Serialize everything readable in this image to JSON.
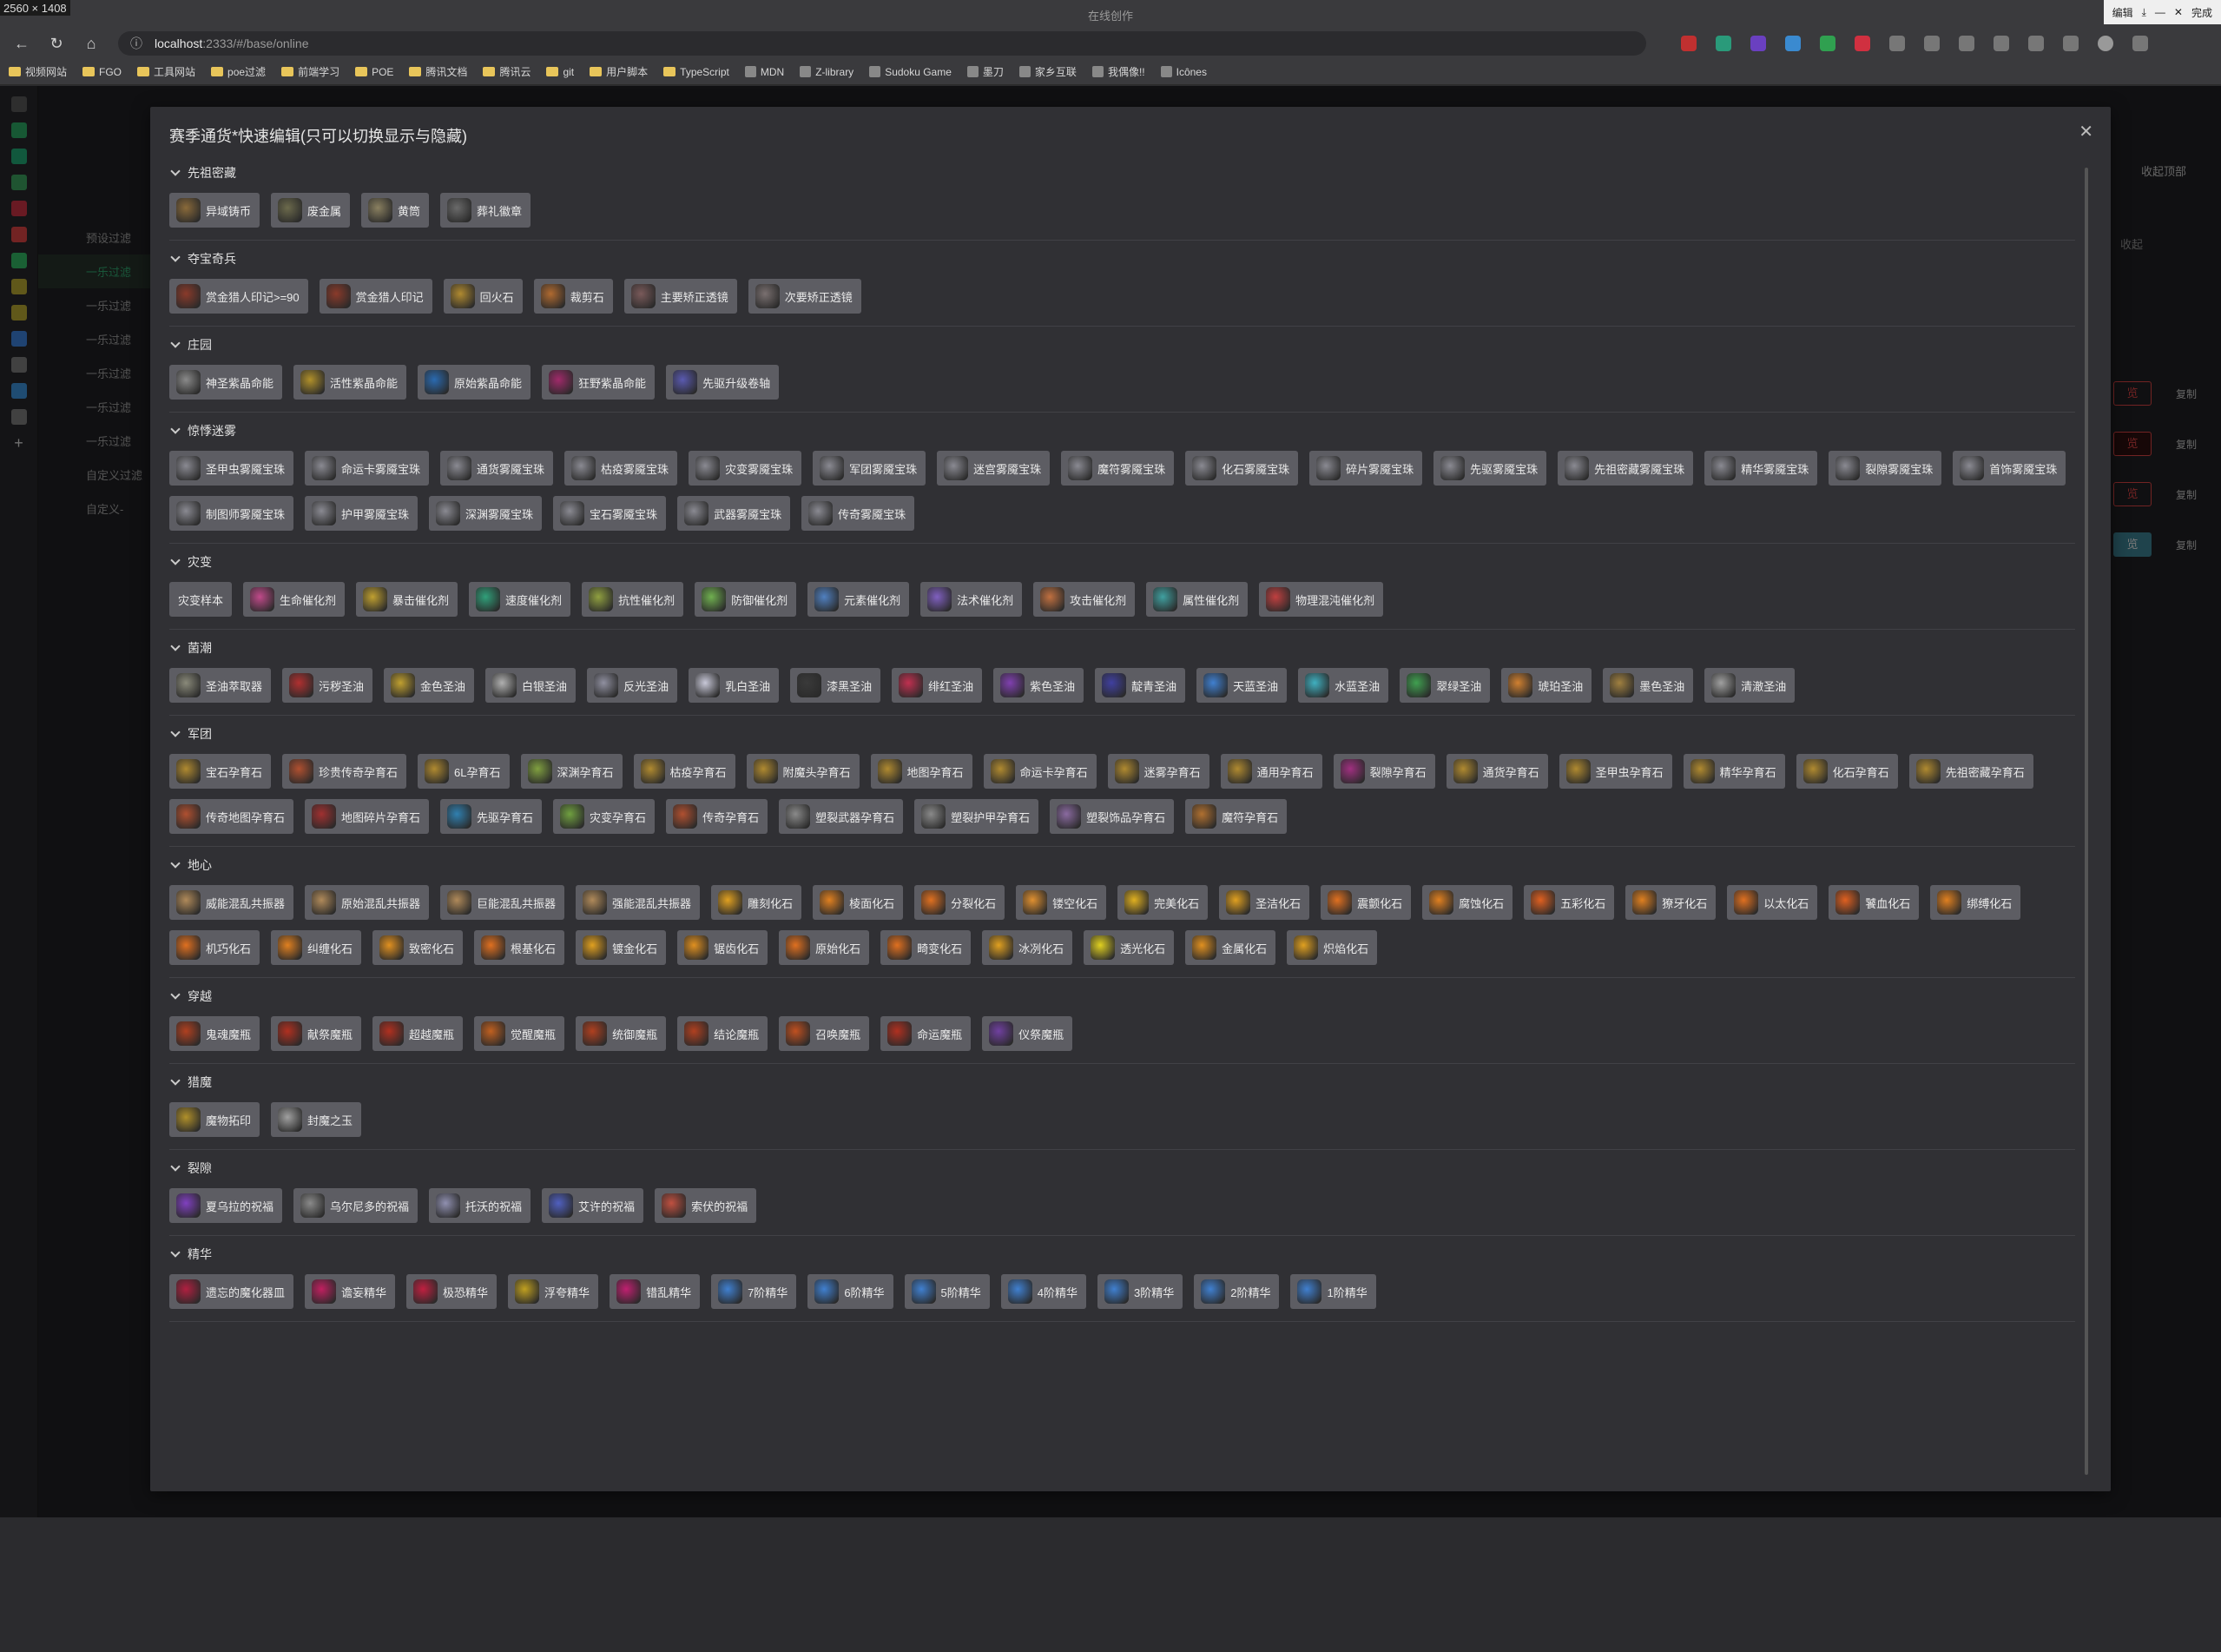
{
  "screen_label": "2560 × 1408",
  "window": {
    "title": "在线创作",
    "controls": [
      "编辑",
      "完成"
    ]
  },
  "browser": {
    "url_host": "localhost",
    "url_rest": ":2333/#/base/online"
  },
  "bookmarks": [
    "视频网站",
    "FGO",
    "工具网站",
    "poe过滤",
    "前端学习",
    "POE",
    "腾讯文档",
    "腾讯云",
    "git",
    "用户脚本",
    "TypeScript",
    "MDN",
    "Z-library",
    "Sudoku Game",
    "墨刀",
    "家乡互联",
    "我偶像!!",
    "Icônes"
  ],
  "app": {
    "left_nav": [
      "预设过滤",
      "一乐过滤",
      "一乐过滤",
      "一乐过滤",
      "一乐过滤",
      "一乐过滤",
      "一乐过滤",
      "自定义过滤",
      "自定义-"
    ],
    "right_actions": {
      "collapse_top": "收起顶部",
      "collapse": "收起"
    },
    "preview_labels": [
      "览",
      "览",
      "览",
      "览"
    ],
    "copy_labels": [
      "复制",
      "复制",
      "复制",
      "复制"
    ]
  },
  "modal": {
    "title": "赛季通货*快速编辑(只可以切换显示与隐藏)",
    "sections": [
      {
        "title": "先祖密藏",
        "items": [
          {
            "label": "异域铸币",
            "icon": "coin-icon",
            "color": "#8a6a3a"
          },
          {
            "label": "废金属",
            "icon": "scrap-icon",
            "color": "#6c6a4c"
          },
          {
            "label": "黄筒",
            "icon": "tube-icon",
            "color": "#8a8060"
          },
          {
            "label": "葬礼徽章",
            "icon": "badge-icon",
            "color": "#6a6a6a"
          }
        ]
      },
      {
        "title": "夺宝奇兵",
        "items": [
          {
            "label": "赏金猎人印记>=90",
            "icon": "mark-icon",
            "color": "#8a3a2a"
          },
          {
            "label": "赏金猎人印记",
            "icon": "mark-icon",
            "color": "#8a3a2a"
          },
          {
            "label": "回火石",
            "icon": "stone-icon",
            "color": "#b08a30"
          },
          {
            "label": "裁剪石",
            "icon": "stone-icon",
            "color": "#b06a30"
          },
          {
            "label": "主要矫正透镜",
            "icon": "lens-icon",
            "color": "#7a5a5a"
          },
          {
            "label": "次要矫正透镜",
            "icon": "lens-icon",
            "color": "#7a7070"
          }
        ]
      },
      {
        "title": "庄园",
        "items": [
          {
            "label": "神圣紫晶命能",
            "icon": "lifeforce-icon",
            "color": "#8a8a8a"
          },
          {
            "label": "活性紫晶命能",
            "icon": "lifeforce-icon",
            "color": "#b0902a"
          },
          {
            "label": "原始紫晶命能",
            "icon": "lifeforce-icon",
            "color": "#2a6ab0"
          },
          {
            "label": "狂野紫晶命能",
            "icon": "lifeforce-icon",
            "color": "#a02a6a"
          },
          {
            "label": "先驱升级卷轴",
            "icon": "scroll-icon",
            "color": "#5a5ab0"
          }
        ]
      },
      {
        "title": "惊悸迷雾",
        "items": [
          {
            "label": "圣甲虫雾魇宝珠",
            "icon": "orb-icon",
            "color": "#8a8a92"
          },
          {
            "label": "命运卡雾魇宝珠",
            "icon": "orb-icon",
            "color": "#8a8a92"
          },
          {
            "label": "通货雾魇宝珠",
            "icon": "orb-icon",
            "color": "#8a8a92"
          },
          {
            "label": "枯疫雾魇宝珠",
            "icon": "orb-icon",
            "color": "#8a8a92"
          },
          {
            "label": "灾变雾魇宝珠",
            "icon": "orb-icon",
            "color": "#8a8a92"
          },
          {
            "label": "军团雾魇宝珠",
            "icon": "orb-icon",
            "color": "#8a8a92"
          },
          {
            "label": "迷宫雾魇宝珠",
            "icon": "orb-icon",
            "color": "#8a8a92"
          },
          {
            "label": "魔符雾魇宝珠",
            "icon": "orb-icon",
            "color": "#8a8a92"
          },
          {
            "label": "化石雾魇宝珠",
            "icon": "orb-icon",
            "color": "#8a8a92"
          },
          {
            "label": "碎片雾魇宝珠",
            "icon": "orb-icon",
            "color": "#8a8a92"
          },
          {
            "label": "先驱雾魇宝珠",
            "icon": "orb-icon",
            "color": "#8a8a92"
          },
          {
            "label": "先祖密藏雾魇宝珠",
            "icon": "orb-icon",
            "color": "#8a8a92"
          },
          {
            "label": "精华雾魇宝珠",
            "icon": "orb-icon",
            "color": "#8a8a92"
          },
          {
            "label": "裂隙雾魇宝珠",
            "icon": "orb-icon",
            "color": "#8a8a92"
          },
          {
            "label": "首饰雾魇宝珠",
            "icon": "orb-icon",
            "color": "#8a8a92"
          },
          {
            "label": "制图师雾魇宝珠",
            "icon": "orb-icon",
            "color": "#8a8a92"
          },
          {
            "label": "护甲雾魇宝珠",
            "icon": "orb-icon",
            "color": "#8a8a92"
          },
          {
            "label": "深渊雾魇宝珠",
            "icon": "orb-icon",
            "color": "#8a8a92"
          },
          {
            "label": "宝石雾魇宝珠",
            "icon": "orb-icon",
            "color": "#8a8a92"
          },
          {
            "label": "武器雾魇宝珠",
            "icon": "orb-icon",
            "color": "#8a8a92"
          },
          {
            "label": "传奇雾魇宝珠",
            "icon": "orb-icon",
            "color": "#8a8a92"
          }
        ]
      },
      {
        "title": "灾变",
        "items": [
          {
            "label": "灾变样本",
            "icon": "",
            "color": ""
          },
          {
            "label": "生命催化剂",
            "icon": "catalyst-icon",
            "color": "#c04a8a"
          },
          {
            "label": "暴击催化剂",
            "icon": "catalyst-icon",
            "color": "#c0a030"
          },
          {
            "label": "速度催化剂",
            "icon": "catalyst-icon",
            "color": "#30a07a"
          },
          {
            "label": "抗性催化剂",
            "icon": "catalyst-icon",
            "color": "#90a040"
          },
          {
            "label": "防御催化剂",
            "icon": "catalyst-icon",
            "color": "#70b050"
          },
          {
            "label": "元素催化剂",
            "icon": "catalyst-icon",
            "color": "#5080c0"
          },
          {
            "label": "法术催化剂",
            "icon": "catalyst-icon",
            "color": "#8060c0"
          },
          {
            "label": "攻击催化剂",
            "icon": "catalyst-icon",
            "color": "#c07040"
          },
          {
            "label": "属性催化剂",
            "icon": "catalyst-icon",
            "color": "#40a0a0"
          },
          {
            "label": "物理混沌催化剂",
            "icon": "catalyst-icon",
            "color": "#c04040"
          }
        ]
      },
      {
        "title": "菌潮",
        "items": [
          {
            "label": "圣油萃取器",
            "icon": "oil-icon",
            "color": "#8a8a7a"
          },
          {
            "label": "污秽圣油",
            "icon": "oil-icon",
            "color": "#b03030"
          },
          {
            "label": "金色圣油",
            "icon": "oil-icon",
            "color": "#c0a030"
          },
          {
            "label": "白银圣油",
            "icon": "oil-icon",
            "color": "#b0b0b0"
          },
          {
            "label": "反光圣油",
            "icon": "oil-icon",
            "color": "#9090a0"
          },
          {
            "label": "乳白圣油",
            "icon": "oil-icon",
            "color": "#c8c8d8"
          },
          {
            "label": "漆黑圣油",
            "icon": "oil-icon",
            "color": "#3a3a3a"
          },
          {
            "label": "绯红圣油",
            "icon": "oil-icon",
            "color": "#c03050"
          },
          {
            "label": "紫色圣油",
            "icon": "oil-icon",
            "color": "#8040b0"
          },
          {
            "label": "靛青圣油",
            "icon": "oil-icon",
            "color": "#4040a0"
          },
          {
            "label": "天蓝圣油",
            "icon": "oil-icon",
            "color": "#4080d0"
          },
          {
            "label": "水蓝圣油",
            "icon": "oil-icon",
            "color": "#40b0c0"
          },
          {
            "label": "翠绿圣油",
            "icon": "oil-icon",
            "color": "#40a050"
          },
          {
            "label": "琥珀圣油",
            "icon": "oil-icon",
            "color": "#d08030"
          },
          {
            "label": "墨色圣油",
            "icon": "oil-icon",
            "color": "#a08040"
          },
          {
            "label": "清澈圣油",
            "icon": "oil-icon",
            "color": "#a0a0a0"
          }
        ]
      },
      {
        "title": "军团",
        "items": [
          {
            "label": "宝石孕育石",
            "icon": "incubator-icon",
            "color": "#b08a30"
          },
          {
            "label": "珍贵传奇孕育石",
            "icon": "incubator-icon",
            "color": "#b05030"
          },
          {
            "label": "6L孕育石",
            "icon": "incubator-icon",
            "color": "#b08a30"
          },
          {
            "label": "深渊孕育石",
            "icon": "incubator-icon",
            "color": "#80a040"
          },
          {
            "label": "枯疫孕育石",
            "icon": "incubator-icon",
            "color": "#b08a30"
          },
          {
            "label": "附魔头孕育石",
            "icon": "incubator-icon",
            "color": "#b08a30"
          },
          {
            "label": "地图孕育石",
            "icon": "incubator-icon",
            "color": "#b08a30"
          },
          {
            "label": "命运卡孕育石",
            "icon": "incubator-icon",
            "color": "#b08a30"
          },
          {
            "label": "迷雾孕育石",
            "icon": "incubator-icon",
            "color": "#b08a30"
          },
          {
            "label": "通用孕育石",
            "icon": "incubator-icon",
            "color": "#b08a30"
          },
          {
            "label": "裂隙孕育石",
            "icon": "incubator-icon",
            "color": "#a03080"
          },
          {
            "label": "通货孕育石",
            "icon": "incubator-icon",
            "color": "#b08a30"
          },
          {
            "label": "圣甲虫孕育石",
            "icon": "incubator-icon",
            "color": "#b08a30"
          },
          {
            "label": "精华孕育石",
            "icon": "incubator-icon",
            "color": "#b08a30"
          },
          {
            "label": "化石孕育石",
            "icon": "incubator-icon",
            "color": "#b08a30"
          },
          {
            "label": "先祖密藏孕育石",
            "icon": "incubator-icon",
            "color": "#b08a30"
          },
          {
            "label": "传奇地图孕育石",
            "icon": "incubator-icon",
            "color": "#b05030"
          },
          {
            "label": "地图碎片孕育石",
            "icon": "incubator-icon",
            "color": "#a03030"
          },
          {
            "label": "先驱孕育石",
            "icon": "incubator-icon",
            "color": "#3080b0"
          },
          {
            "label": "灾变孕育石",
            "icon": "incubator-icon",
            "color": "#70a040"
          },
          {
            "label": "传奇孕育石",
            "icon": "incubator-icon",
            "color": "#b05030"
          },
          {
            "label": "塑裂武器孕育石",
            "icon": "incubator-icon",
            "color": "#8a8a8a"
          },
          {
            "label": "塑裂护甲孕育石",
            "icon": "incubator-icon",
            "color": "#8a8a8a"
          },
          {
            "label": "塑裂饰品孕育石",
            "icon": "incubator-icon",
            "color": "#8a6aa0"
          },
          {
            "label": "魔符孕育石",
            "icon": "incubator-icon",
            "color": "#b07030"
          }
        ]
      },
      {
        "title": "地心",
        "items": [
          {
            "label": "威能混乱共振器",
            "icon": "resonator-icon",
            "color": "#b08a5a"
          },
          {
            "label": "原始混乱共振器",
            "icon": "resonator-icon",
            "color": "#b08a5a"
          },
          {
            "label": "巨能混乱共振器",
            "icon": "resonator-icon",
            "color": "#b08a5a"
          },
          {
            "label": "强能混乱共振器",
            "icon": "resonator-icon",
            "color": "#b08a5a"
          },
          {
            "label": "雕刻化石",
            "icon": "fossil-icon",
            "color": "#e0a020"
          },
          {
            "label": "棱面化石",
            "icon": "fossil-icon",
            "color": "#e08020"
          },
          {
            "label": "分裂化石",
            "icon": "fossil-icon",
            "color": "#e07020"
          },
          {
            "label": "镂空化石",
            "icon": "fossil-icon",
            "color": "#e09030"
          },
          {
            "label": "完美化石",
            "icon": "fossil-icon",
            "color": "#e0b020"
          },
          {
            "label": "圣洁化石",
            "icon": "fossil-icon",
            "color": "#e0a020"
          },
          {
            "label": "震颤化石",
            "icon": "fossil-icon",
            "color": "#e07020"
          },
          {
            "label": "腐蚀化石",
            "icon": "fossil-icon",
            "color": "#e08020"
          },
          {
            "label": "五彩化石",
            "icon": "fossil-icon",
            "color": "#e06020"
          },
          {
            "label": "獠牙化石",
            "icon": "fossil-icon",
            "color": "#e08020"
          },
          {
            "label": "以太化石",
            "icon": "fossil-icon",
            "color": "#e07020"
          },
          {
            "label": "饕血化石",
            "icon": "fossil-icon",
            "color": "#e06020"
          },
          {
            "label": "绑缚化石",
            "icon": "fossil-icon",
            "color": "#e08020"
          },
          {
            "label": "机巧化石",
            "icon": "fossil-icon",
            "color": "#e07020"
          },
          {
            "label": "纠缠化石",
            "icon": "fossil-icon",
            "color": "#e08020"
          },
          {
            "label": "致密化石",
            "icon": "fossil-icon",
            "color": "#e09020"
          },
          {
            "label": "根基化石",
            "icon": "fossil-icon",
            "color": "#e07020"
          },
          {
            "label": "镀金化石",
            "icon": "fossil-icon",
            "color": "#e0a020"
          },
          {
            "label": "锯齿化石",
            "icon": "fossil-icon",
            "color": "#e09020"
          },
          {
            "label": "原始化石",
            "icon": "fossil-icon",
            "color": "#e07020"
          },
          {
            "label": "畸变化石",
            "icon": "fossil-icon",
            "color": "#e07020"
          },
          {
            "label": "冰冽化石",
            "icon": "fossil-icon",
            "color": "#e0a020"
          },
          {
            "label": "透光化石",
            "icon": "fossil-icon",
            "color": "#e0d020"
          },
          {
            "label": "金属化石",
            "icon": "fossil-icon",
            "color": "#e09020"
          },
          {
            "label": "炽焰化石",
            "icon": "fossil-icon",
            "color": "#e0a020"
          }
        ]
      },
      {
        "title": "穿越",
        "items": [
          {
            "label": "鬼魂魔瓶",
            "icon": "vial-icon",
            "color": "#b04020"
          },
          {
            "label": "献祭魔瓶",
            "icon": "vial-icon",
            "color": "#b03020"
          },
          {
            "label": "超越魔瓶",
            "icon": "vial-icon",
            "color": "#b03020"
          },
          {
            "label": "觉醒魔瓶",
            "icon": "vial-icon",
            "color": "#c06020"
          },
          {
            "label": "统御魔瓶",
            "icon": "vial-icon",
            "color": "#b04020"
          },
          {
            "label": "结论魔瓶",
            "icon": "vial-icon",
            "color": "#b04020"
          },
          {
            "label": "召唤魔瓶",
            "icon": "vial-icon",
            "color": "#c05020"
          },
          {
            "label": "命运魔瓶",
            "icon": "vial-icon",
            "color": "#b03020"
          },
          {
            "label": "仪祭魔瓶",
            "icon": "vial-icon",
            "color": "#7040a0"
          }
        ]
      },
      {
        "title": "猎魔",
        "items": [
          {
            "label": "魔物拓印",
            "icon": "imprint-icon",
            "color": "#b0902a"
          },
          {
            "label": "封魔之玉",
            "icon": "jade-icon",
            "color": "#a0a0a0"
          }
        ]
      },
      {
        "title": "裂隙",
        "items": [
          {
            "label": "夏乌拉的祝福",
            "icon": "blessing-icon",
            "color": "#8040c0"
          },
          {
            "label": "乌尔尼多的祝福",
            "icon": "blessing-icon",
            "color": "#8a8a8a"
          },
          {
            "label": "托沃的祝福",
            "icon": "blessing-icon",
            "color": "#9090b0"
          },
          {
            "label": "艾许的祝福",
            "icon": "blessing-icon",
            "color": "#5060c0"
          },
          {
            "label": "索伏的祝福",
            "icon": "blessing-icon",
            "color": "#c05040"
          }
        ]
      },
      {
        "title": "精华",
        "items": [
          {
            "label": "遗忘的魔化器皿",
            "icon": "vessel-icon",
            "color": "#b02040"
          },
          {
            "label": "谵妄精华",
            "icon": "essence-icon",
            "color": "#c02060"
          },
          {
            "label": "极恐精华",
            "icon": "essence-icon",
            "color": "#c02040"
          },
          {
            "label": "浮夸精华",
            "icon": "essence-icon",
            "color": "#c0a020"
          },
          {
            "label": "错乱精华",
            "icon": "essence-icon",
            "color": "#c02070"
          },
          {
            "label": "7阶精华",
            "icon": "essence-icon",
            "color": "#4080d0"
          },
          {
            "label": "6阶精华",
            "icon": "essence-icon",
            "color": "#4080d0"
          },
          {
            "label": "5阶精华",
            "icon": "essence-icon",
            "color": "#4080d0"
          },
          {
            "label": "4阶精华",
            "icon": "essence-icon",
            "color": "#4080d0"
          },
          {
            "label": "3阶精华",
            "icon": "essence-icon",
            "color": "#4080d0"
          },
          {
            "label": "2阶精华",
            "icon": "essence-icon",
            "color": "#4080d0"
          },
          {
            "label": "1阶精华",
            "icon": "essence-icon",
            "color": "#4080d0"
          }
        ]
      }
    ]
  }
}
